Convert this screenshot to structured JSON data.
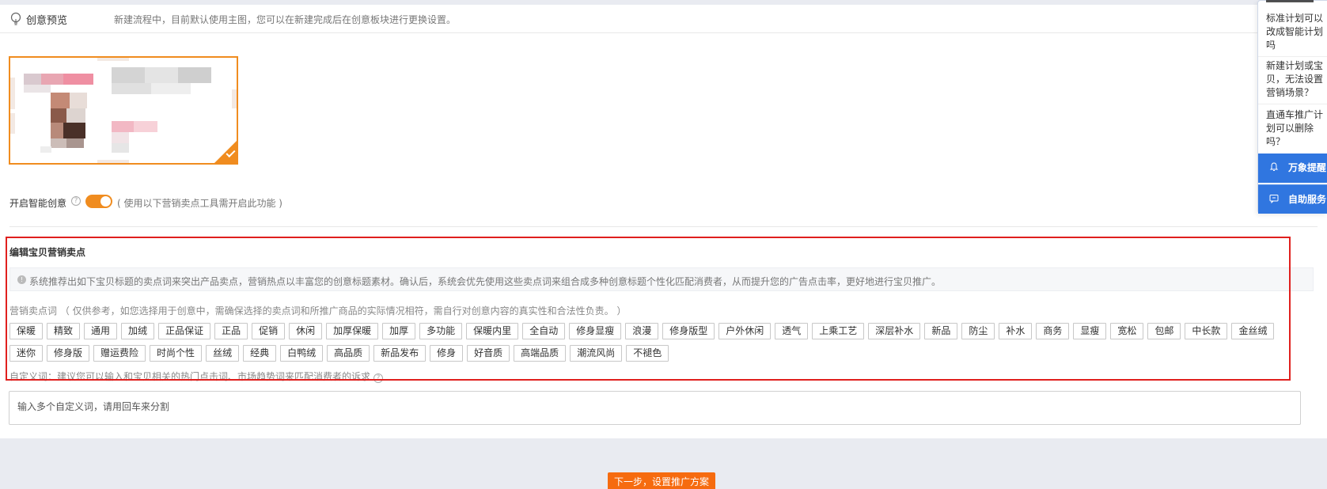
{
  "preview": {
    "label": "创意预览",
    "note": "新建流程中，目前默认使用主图，您可以在新建完成后在创意板块进行更换设置。"
  },
  "smart_creative": {
    "label": "开启智能创意",
    "hint": "( 使用以下营销卖点工具需开启此功能 )",
    "enabled": true
  },
  "selling_points": {
    "title": "编辑宝贝营销卖点",
    "info": "系统推荐出如下宝贝标题的卖点词来突出产品卖点，营销热点以丰富您的创意标题素材。确认后，系统会优先使用这些卖点词来组合成多种创意标题个性化匹配消费者，从而提升您的广告点击率，更好地进行宝贝推广。",
    "keywords_label": "营销卖点词 （ 仅供参考，如您选择用于创意中，需确保选择的卖点词和所推广商品的实际情况相符，需自行对创意内容的真实性和合法性负责。 ）",
    "tags_row1": [
      "保暖",
      "精致",
      "通用",
      "加绒",
      "正品保证",
      "正品",
      "促销",
      "休闲",
      "加厚保暖",
      "加厚",
      "多功能",
      "保暖内里",
      "全自动",
      "修身显瘦",
      "浪漫",
      "修身版型",
      "户外休闲",
      "透气",
      "上乘工艺",
      "深层补水",
      "新品",
      "防尘",
      "补水",
      "商务",
      "显瘦",
      "宽松",
      "包邮",
      "中长款",
      "金丝绒"
    ],
    "tags_row2": [
      "迷你",
      "修身版",
      "赠运费险",
      "时尚个性",
      "丝绒",
      "经典",
      "白鸭绒",
      "高品质",
      "新品发布",
      "修身",
      "好音质",
      "高端品质",
      "潮流风尚",
      "不褪色"
    ],
    "custom_label": "自定义词：建议您可以输入和宝贝相关的热门点击词、市场趋势词来匹配消费者的诉求",
    "custom_placeholder": "输入多个自定义词，请用回车来分割"
  },
  "footer": {
    "next_button": "下一步，设置推广方案"
  },
  "side_panel": {
    "questions": [
      "标准计划可以改成智能计划吗",
      "新建计划或宝贝，无法设置营销场景？",
      "直通车推广计划可以删除吗？"
    ],
    "remind_label": "万象提醒",
    "service_label": "自助服务"
  },
  "colors": {
    "accent": "#f08c1f",
    "button": "#f66b0f",
    "highlight_box": "#e0201e",
    "side_blue": "#3076e0"
  }
}
